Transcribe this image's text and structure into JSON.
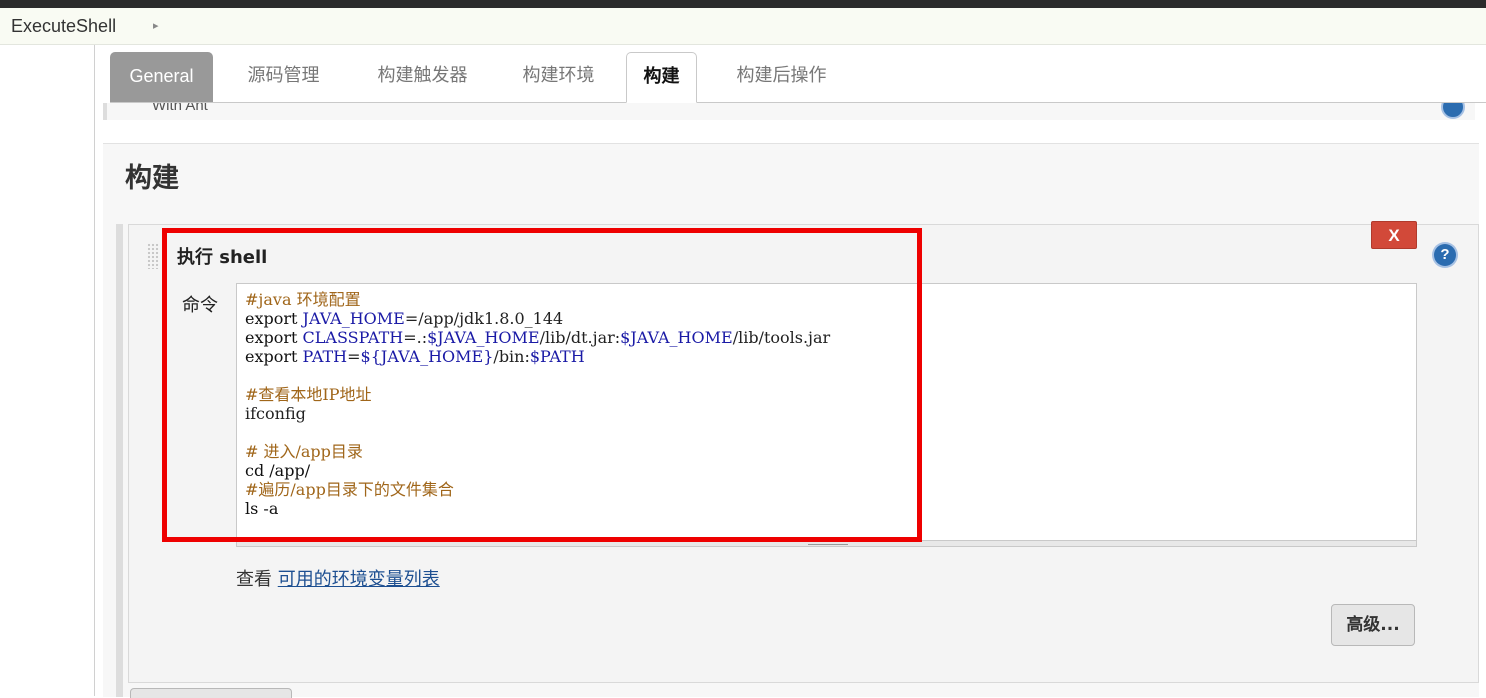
{
  "breadcrumb": {
    "item": "ExecuteShell",
    "arrow": "▸"
  },
  "tabs": [
    {
      "label": "General"
    },
    {
      "label": "源码管理"
    },
    {
      "label": "构建触发器"
    },
    {
      "label": "构建环境"
    },
    {
      "label": "构建"
    },
    {
      "label": "构建后操作"
    }
  ],
  "partial_above": {
    "text": "With Ant"
  },
  "section": {
    "title": "构建"
  },
  "step": {
    "title": "执行 shell",
    "delete_label": "X",
    "help_label": "?",
    "command_label": "命令",
    "command_lines": [
      {
        "parts": [
          {
            "t": "#java 环境配置",
            "c": "comment"
          }
        ]
      },
      {
        "parts": [
          {
            "t": "export ",
            "c": "kw"
          },
          {
            "t": "JAVA_HOME",
            "c": "var"
          },
          {
            "t": "=/app/jdk1.8.0_144",
            "c": "plain"
          }
        ]
      },
      {
        "parts": [
          {
            "t": "export ",
            "c": "kw"
          },
          {
            "t": "CLASSPATH",
            "c": "var"
          },
          {
            "t": "=.:",
            "c": "plain"
          },
          {
            "t": "$JAVA_HOME",
            "c": "var"
          },
          {
            "t": "/lib/dt.jar:",
            "c": "plain"
          },
          {
            "t": "$JAVA_HOME",
            "c": "var"
          },
          {
            "t": "/lib/tools.jar",
            "c": "plain"
          }
        ]
      },
      {
        "parts": [
          {
            "t": "export ",
            "c": "kw"
          },
          {
            "t": "PATH",
            "c": "var"
          },
          {
            "t": "=",
            "c": "plain"
          },
          {
            "t": "${JAVA_HOME}",
            "c": "var"
          },
          {
            "t": "/bin:",
            "c": "plain"
          },
          {
            "t": "$PATH",
            "c": "var"
          }
        ]
      },
      {
        "parts": []
      },
      {
        "parts": [
          {
            "t": "#查看本地IP地址",
            "c": "comment"
          }
        ]
      },
      {
        "parts": [
          {
            "t": "ifconfig",
            "c": "plain"
          }
        ]
      },
      {
        "parts": []
      },
      {
        "parts": [
          {
            "t": "# 进入/app目录",
            "c": "comment"
          }
        ]
      },
      {
        "parts": [
          {
            "t": "cd /app/",
            "c": "kw"
          }
        ]
      },
      {
        "parts": [
          {
            "t": "#遍历/app目录下的文件集合",
            "c": "comment"
          }
        ]
      },
      {
        "parts": [
          {
            "t": "ls -a",
            "c": "kw"
          }
        ]
      }
    ],
    "env_prefix": "查看 ",
    "env_link": "可用的环境变量列表",
    "advanced_label": "高级..."
  },
  "colors": {
    "highlight": "#ee0000",
    "delete": "#d24939",
    "link": "#1d4f91",
    "comment": "#a0661a",
    "variable": "#1a1aa6"
  }
}
